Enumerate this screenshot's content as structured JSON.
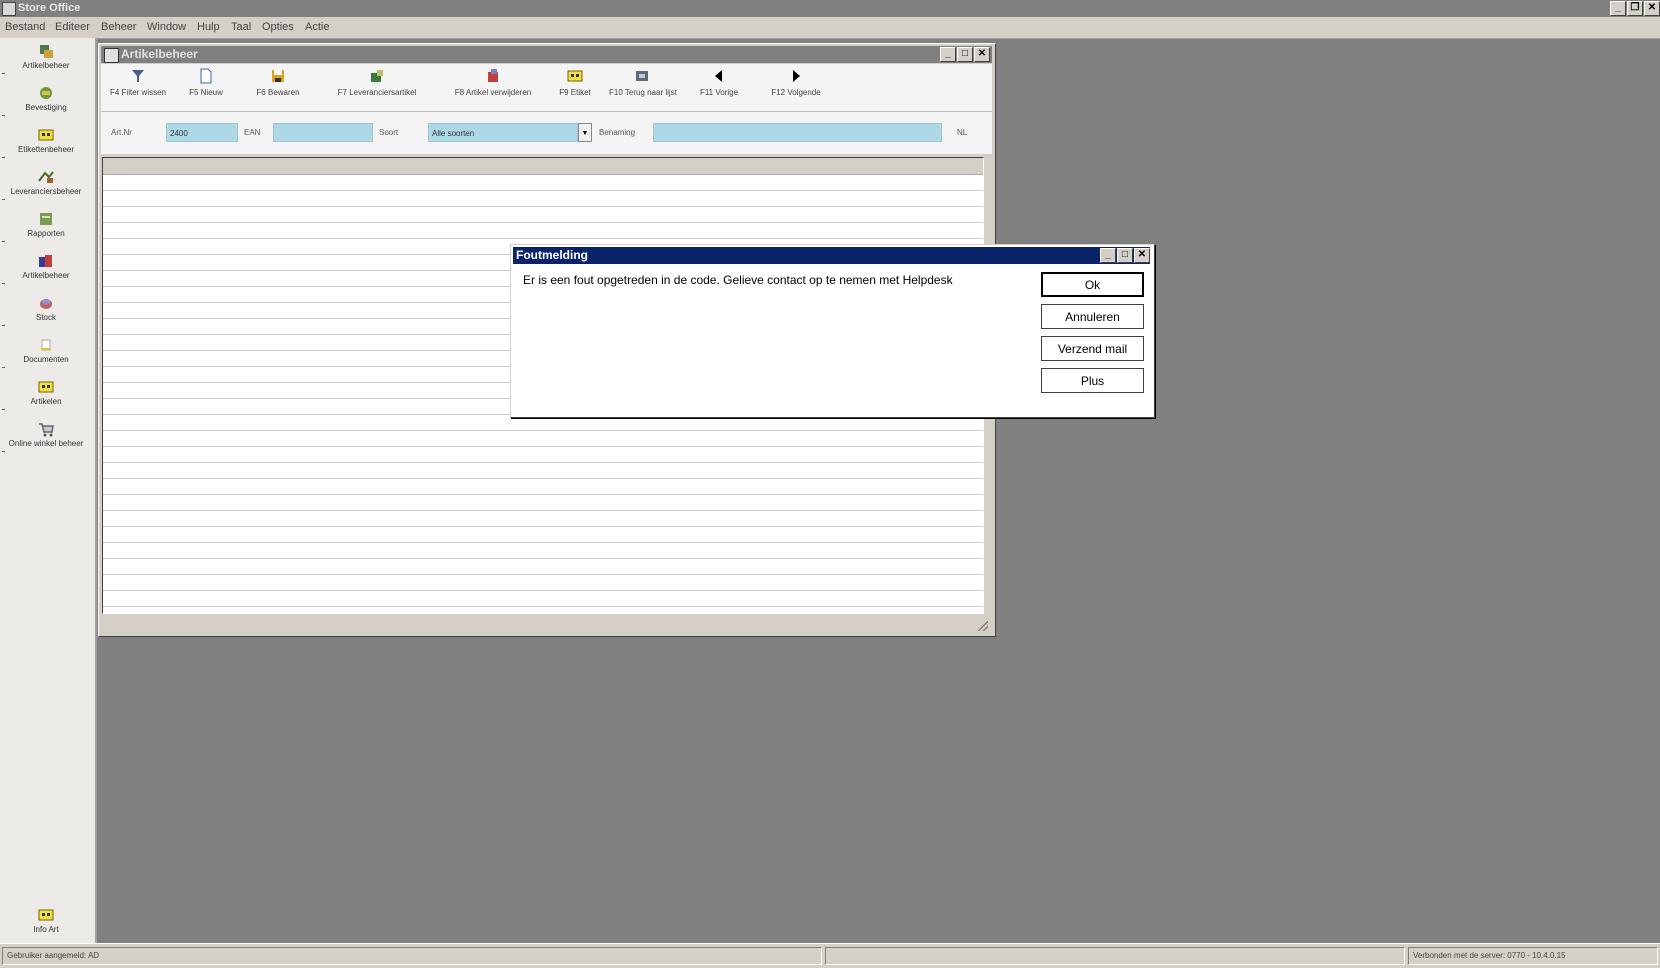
{
  "app": {
    "title": "Store Office"
  },
  "menu": [
    "Bestand",
    "Editeer",
    "Beheer",
    "Window",
    "Hulp",
    "Taal",
    "Opties",
    "Actie"
  ],
  "sidebar": {
    "items": [
      {
        "label": "Artikelbeheer",
        "icon": "articles-icon"
      },
      {
        "label": "Bevestiging",
        "icon": "confirm-icon"
      },
      {
        "label": "Etikettenbeheer",
        "icon": "labels-icon"
      },
      {
        "label": "Leveranciersbeheer",
        "icon": "supplier-icon"
      },
      {
        "label": "Rapporten",
        "icon": "reports-icon"
      },
      {
        "label": "Artikelbeheer",
        "icon": "manage-icon"
      },
      {
        "label": "Stock",
        "icon": "stock-icon"
      },
      {
        "label": "Documenten",
        "icon": "documents-icon"
      },
      {
        "label": "Artikelen",
        "icon": "items-icon"
      },
      {
        "label": "Online winkel beheer",
        "icon": "cart-icon"
      }
    ],
    "bottom_item": {
      "label": "Info Art",
      "icon": "info-icon"
    }
  },
  "artikel_window": {
    "title": "Artikelbeheer",
    "toolbar": [
      {
        "label": "F4 Filter wissen",
        "icon": "filter-icon"
      },
      {
        "label": "F5 Nieuw",
        "icon": "new-icon"
      },
      {
        "label": "F6 Bewaren",
        "icon": "save-icon"
      },
      {
        "label": "F7 Leveranciersartikel",
        "icon": "supplier-article-icon"
      },
      {
        "label": "F8 Artikel verwijderen",
        "icon": "delete-icon"
      },
      {
        "label": "F9 Etiket",
        "icon": "label-icon"
      },
      {
        "label": "F10 Terug naar lijst",
        "icon": "back-list-icon"
      },
      {
        "label": "F11 Vorige",
        "icon": "previous-icon"
      },
      {
        "label": "F12 Volgende",
        "icon": "next-icon"
      }
    ],
    "filters": {
      "artnr_label": "Art.Nr",
      "artnr_value": "2400",
      "ean_label": "EAN",
      "ean_value": "",
      "soort_label": "Soort",
      "soort_value": "Alle soorten",
      "benaming_label": "Benaming",
      "benaming_value": "",
      "nl_label": "NL"
    }
  },
  "dialog": {
    "title": "Foutmelding",
    "message": "Er is een fout opgetreden in de code. Gelieve contact op te nemen met Helpdesk",
    "buttons": {
      "ok": "Ok",
      "cancel": "Annuleren",
      "mail": "Verzend mail",
      "plus": "Plus"
    }
  },
  "statusbar": {
    "left": "Gebruiker aangemeld: AD",
    "right": "Verbonden met de server: 0770 - 10.4.0.15"
  }
}
